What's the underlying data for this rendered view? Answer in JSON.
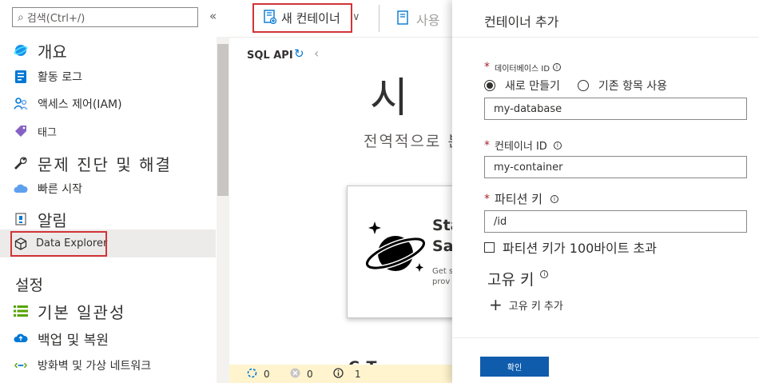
{
  "sidebar": {
    "search_placeholder": "검색(Ctrl+/)",
    "collapse": "«",
    "items": [
      {
        "label": "개요"
      },
      {
        "label": "활동 로그"
      },
      {
        "label": "액세스 제어(IAM)"
      },
      {
        "label": "태그"
      },
      {
        "label": "문제 진단 및 해결"
      },
      {
        "label": "빠른 시작"
      },
      {
        "label": "알림"
      },
      {
        "label": "Data Explorer"
      }
    ],
    "section_settings": "설정",
    "settings_items": [
      {
        "label": "기본 일관성"
      },
      {
        "label": "백업 및 복원"
      },
      {
        "label": "방화벽 및 가상 네트워크"
      }
    ]
  },
  "toolbar": {
    "new_container": "새 컨테이너",
    "chevron": "∨",
    "usage": "사용"
  },
  "explorer": {
    "api_label": "SQL API",
    "hero_title": "시 ",
    "hero_subtitle": "전역적으로 분",
    "card_title_1": "Sta",
    "card_title_2": "Sar",
    "card_desc_1": "Get s",
    "card_desc_2": "prov",
    "bottom_text": "C      T   "
  },
  "status": {
    "in_progress": "0",
    "errors": "0",
    "info": "1"
  },
  "panel": {
    "title": "컨테이너 추가",
    "database_id_label": "데이터베이스 ID",
    "radio_new": "새로 만들기",
    "radio_existing": "기존 항목 사용",
    "database_value": "my-database",
    "container_id_label": "컨테이너 ID",
    "container_value": "my-container",
    "partition_key_label": "파티션 키",
    "partition_value": "/id",
    "large_partition_label": "파티션 키가 100바이트 초과",
    "unique_key_label": "고유 키",
    "add_unique_key": "고유 키 추가",
    "ok": "확인"
  },
  "colors": {
    "accent": "#0078d4",
    "highlight_border": "#d13438",
    "primary_button": "#0f5cad",
    "status_bar": "#fff4ce"
  }
}
